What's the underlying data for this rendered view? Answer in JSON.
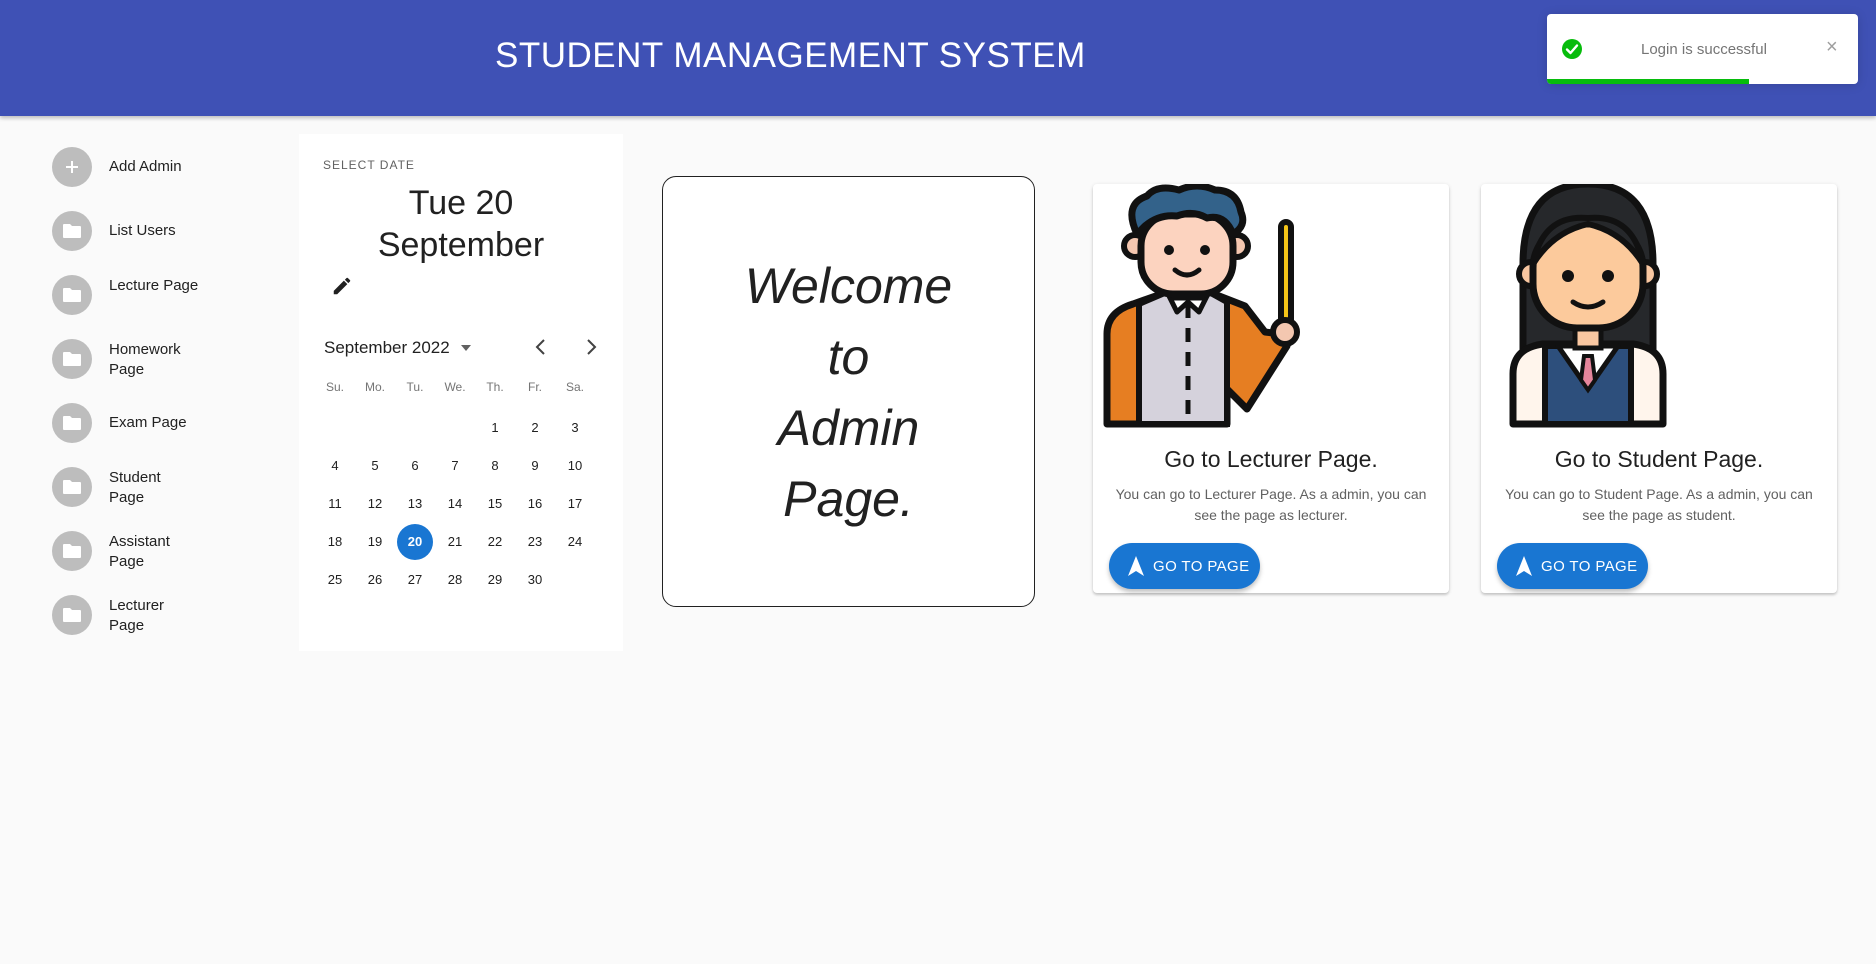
{
  "header": {
    "title": "STUDENT MANAGEMENT SYSTEM",
    "color": "#3f51b5"
  },
  "toast": {
    "message": "Login is successful",
    "close": "×",
    "progress": 0.65,
    "accent": "#07bc0c"
  },
  "sidebar": {
    "items": [
      {
        "label": "Add Admin",
        "icon": "plus-icon"
      },
      {
        "label": "List Users",
        "icon": "folder-icon"
      },
      {
        "label": "Lecture Page",
        "icon": "folder-icon"
      },
      {
        "label": "Homework Page",
        "icon": "folder-icon"
      },
      {
        "label": "Exam Page",
        "icon": "folder-icon"
      },
      {
        "label": "Student Page",
        "icon": "folder-icon"
      },
      {
        "label": "Assistant Page",
        "icon": "folder-icon"
      },
      {
        "label": "Lecturer Page",
        "icon": "folder-icon"
      }
    ]
  },
  "calendar": {
    "overline": "SELECT DATE",
    "selected_line1": "Tue 20",
    "selected_line2": "September",
    "month_label": "September 2022",
    "weekdays": [
      "Su.",
      "Mo.",
      "Tu.",
      "We.",
      "Th.",
      "Fr.",
      "Sa."
    ],
    "days": [
      "1",
      "2",
      "3",
      "4",
      "5",
      "6",
      "7",
      "8",
      "9",
      "10",
      "11",
      "12",
      "13",
      "14",
      "15",
      "16",
      "17",
      "18",
      "19",
      "20",
      "21",
      "22",
      "23",
      "24",
      "25",
      "26",
      "27",
      "28",
      "29",
      "30"
    ],
    "selected_day": "20",
    "accent": "#1976d2"
  },
  "welcome": {
    "lines": [
      "Welcome",
      "to",
      "Admin",
      "Page."
    ]
  },
  "cards": [
    {
      "title": "Go to Lecturer Page.",
      "description": "You can go to Lecturer Page. As a admin, you can see the page as lecturer.",
      "button": "GO TO PAGE",
      "image": "lecturer-illustration"
    },
    {
      "title": "Go to Student Page.",
      "description": "You can go to Student Page. As a admin, you can see the page as student.",
      "button": "GO TO PAGE",
      "image": "student-illustration"
    }
  ]
}
